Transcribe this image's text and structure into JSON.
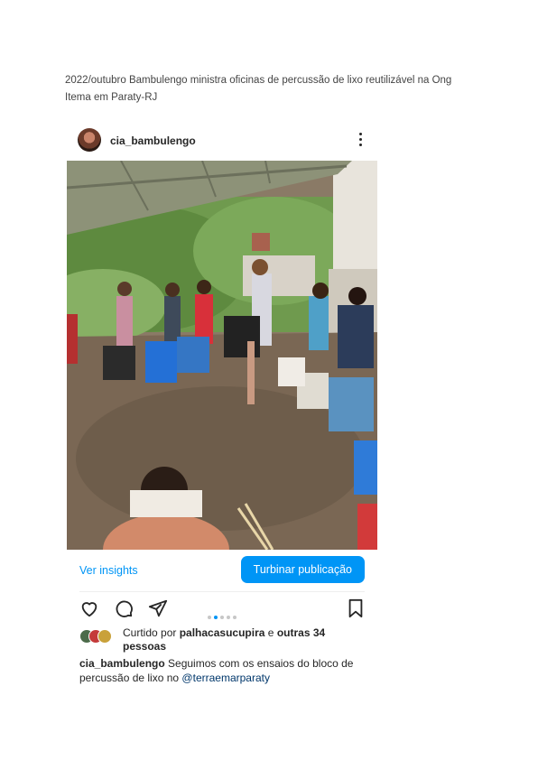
{
  "document": {
    "caption": "2022/outubro Bambulengo ministra oficinas de percussão de lixo reutilizável na Ong Itema em Paraty-RJ"
  },
  "post": {
    "username": "cia_bambulengo",
    "insights_label": "Ver insights",
    "boost_label": "Turbinar publicação",
    "carousel": {
      "total": 5,
      "active": 1
    },
    "likes": {
      "prefix": "Curtido por",
      "user": "palhacasucupira",
      "connector": "e",
      "others": "outras 34 pessoas"
    },
    "caption": {
      "username": "cia_bambulengo",
      "text": "Seguimos com os ensaios do bloco de percussão de lixo no",
      "mention": "@terraemarparaty"
    }
  },
  "icons": [
    "more-vertical-icon",
    "heart-icon",
    "comment-icon",
    "share-icon",
    "bookmark-icon"
  ],
  "colors": {
    "accent": "#0095f6",
    "mention": "#00376b",
    "text": "#262626"
  }
}
